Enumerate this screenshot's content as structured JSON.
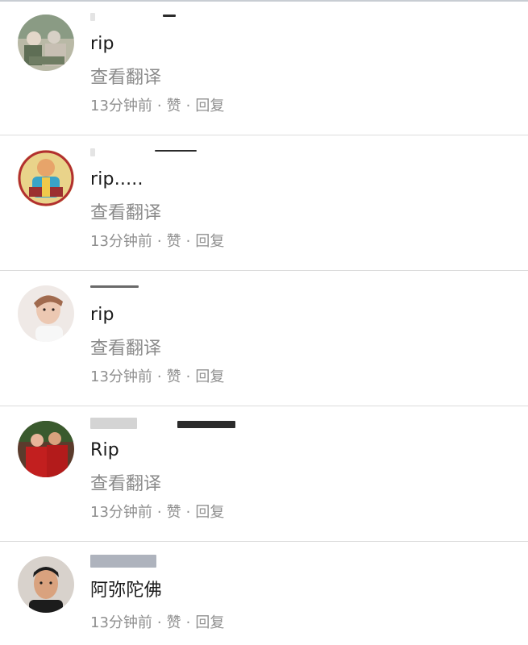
{
  "translate_label": "查看翻译",
  "like_label": "赞",
  "reply_label": "回复",
  "separator": "·",
  "comments": [
    {
      "text": "rip",
      "time": "13分钟前",
      "avatar_colors": [
        "#8a9b84",
        "#d7d0c6",
        "#5e6e55"
      ]
    },
    {
      "text": "rip.....",
      "time": "13分钟前",
      "avatar_colors": [
        "#f0c94a",
        "#3aa4c7",
        "#b22f2f"
      ]
    },
    {
      "text": "rip",
      "time": "13分钟前",
      "avatar_colors": [
        "#efe9e6",
        "#a06a4e",
        "#2c2320"
      ]
    },
    {
      "text": "Rip",
      "time": "13分钟前",
      "avatar_colors": [
        "#c21f1f",
        "#3a5a2e",
        "#e8b59a"
      ]
    },
    {
      "text": "阿弥陀佛",
      "time": "13分钟前",
      "avatar_colors": [
        "#d8d2cc",
        "#1c1c1c",
        "#d9a27e"
      ]
    }
  ]
}
